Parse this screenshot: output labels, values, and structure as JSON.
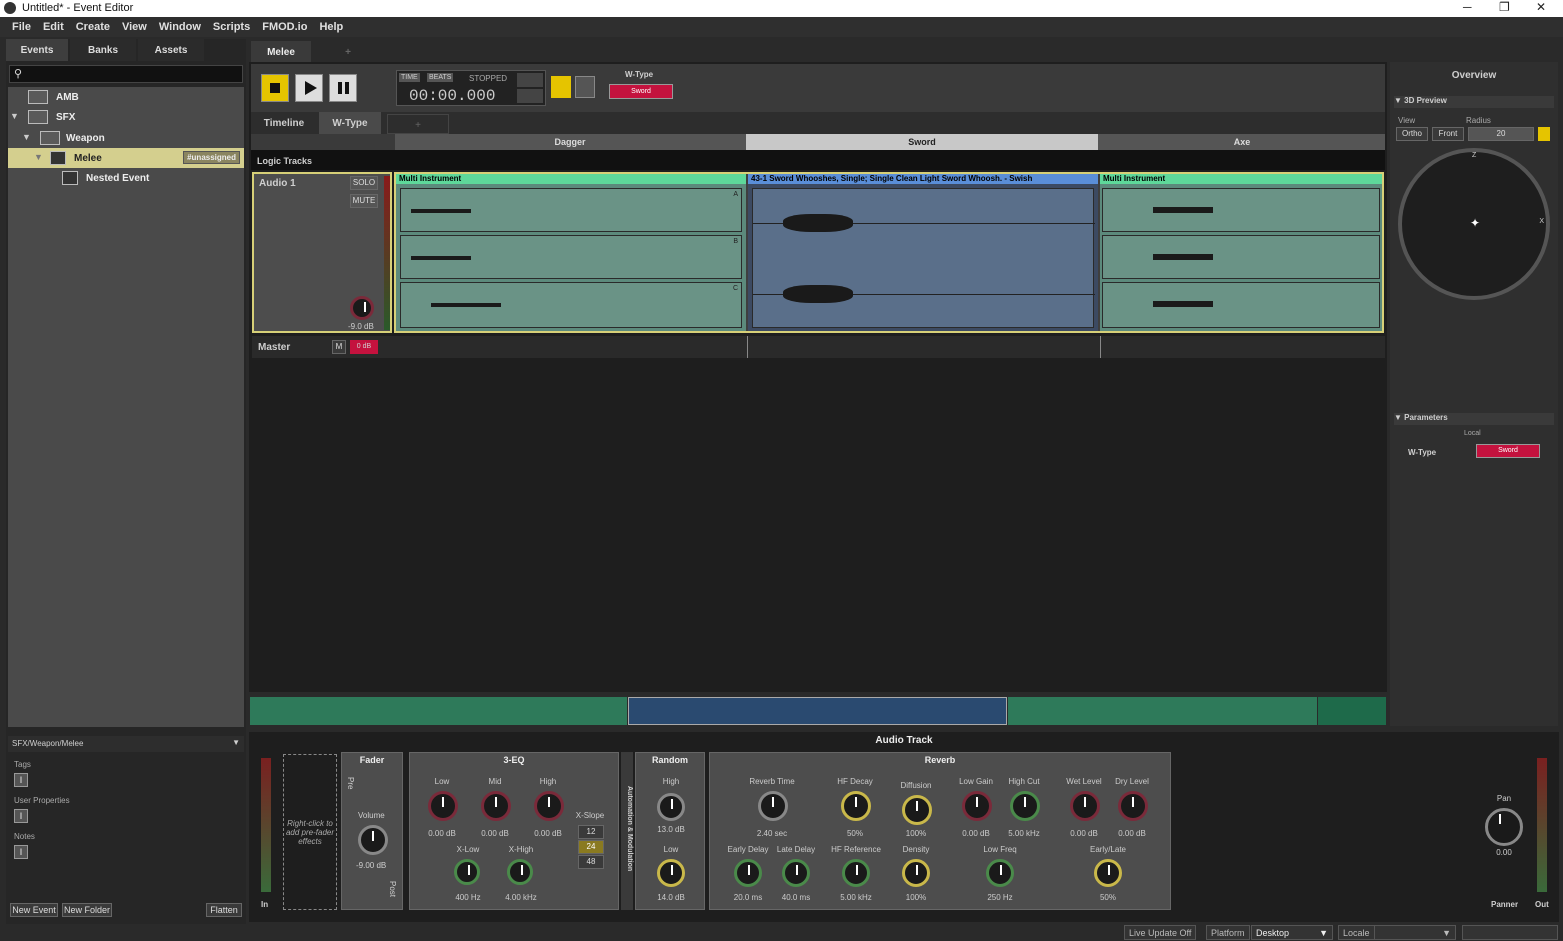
{
  "window": {
    "title": "Untitled* - Event Editor"
  },
  "menu": [
    "File",
    "Edit",
    "Create",
    "View",
    "Window",
    "Scripts",
    "FMOD.io",
    "Help"
  ],
  "browser": {
    "tabs": [
      "Events",
      "Banks",
      "Assets"
    ],
    "tree": [
      {
        "label": "AMB"
      },
      {
        "label": "SFX"
      },
      {
        "label": "Weapon"
      },
      {
        "label": "Melee",
        "badge": "#unassigned"
      },
      {
        "label": "Nested Event"
      }
    ],
    "path": "SFX/Weapon/Melee",
    "tags_label": "Tags",
    "userprops_label": "User Properties",
    "notes_label": "Notes",
    "new_event": "New Event",
    "new_folder": "New Folder",
    "flatten": "Flatten"
  },
  "editor": {
    "tab": "Melee",
    "add_tab": "+",
    "transport": {
      "time_label": "TIME",
      "beats_label": "BEATS",
      "state": "STOPPED",
      "time": "00:00.000",
      "param_label": "W-Type",
      "param_value": "Sword"
    },
    "subtabs": [
      "Timeline",
      "W-Type",
      "+"
    ],
    "ruler": [
      "Dagger",
      "Sword",
      "Axe"
    ],
    "logic_tracks": "Logic Tracks",
    "track": {
      "name": "Audio 1",
      "solo": "SOLO",
      "mute": "MUTE",
      "volume": "-9.0 dB"
    },
    "instruments": [
      {
        "name": "Multi Instrument",
        "color": "#5ed89a"
      },
      {
        "name": "43-1 Sword Whooshes, Single; Single Clean Light Sword Whoosh. - Swish",
        "color": "#5a8ed8"
      },
      {
        "name": "Multi Instrument",
        "color": "#5ed89a"
      }
    ],
    "playlist_labels": [
      "A",
      "B",
      "C"
    ],
    "master": {
      "name": "Master",
      "m": "M",
      "level": "0 dB"
    }
  },
  "overview": {
    "title": "Overview",
    "preview": "3D Preview",
    "view_label": "View",
    "radius_label": "Radius",
    "ortho": "Ortho",
    "front": "Front",
    "radius": "20",
    "z": "Z",
    "x": "X",
    "parameters": "Parameters",
    "local": "Local",
    "param": "W-Type",
    "param_value": "Sword"
  },
  "deck": {
    "title": "Audio Track",
    "in": "In",
    "prefader": "Right-click to add pre-fader effects",
    "fader": {
      "title": "Fader",
      "pre": "Pre",
      "post": "Post",
      "volume_label": "Volume",
      "volume": "-9.00 dB"
    },
    "eq": {
      "title": "3-EQ",
      "low": "Low",
      "mid": "Mid",
      "high": "High",
      "low_v": "0.00 dB",
      "mid_v": "0.00 dB",
      "high_v": "0.00 dB",
      "xlow": "X-Low",
      "xhigh": "X-High",
      "xlow_v": "400 Hz",
      "xhigh_v": "4.00 kHz",
      "xslope": "X-Slope",
      "s12": "12",
      "s24": "24",
      "s48": "48"
    },
    "mod": "Automation & Modulation",
    "random": {
      "title": "Random",
      "high": "High",
      "high_v": "13.0 dB",
      "low": "Low",
      "low_v": "14.0 dB"
    },
    "reverb": {
      "title": "Reverb",
      "rt": "Reverb Time",
      "rt_v": "2.40 sec",
      "hfd": "HF Decay",
      "hfd_v": "50%",
      "diff": "Diffusion",
      "diff_v": "100%",
      "lg": "Low Gain",
      "lg_v": "0.00 dB",
      "hc": "High Cut",
      "hc_v": "5.00 kHz",
      "wl": "Wet Level",
      "wl_v": "0.00 dB",
      "dl": "Dry Level",
      "dl_v": "0.00 dB",
      "ed": "Early Delay",
      "ed_v": "20.0 ms",
      "ld": "Late Delay",
      "ld_v": "40.0 ms",
      "hfr": "HF Reference",
      "hfr_v": "5.00 kHz",
      "den": "Density",
      "den_v": "100%",
      "lf": "Low Freq",
      "lf_v": "250 Hz",
      "el": "Early/Late",
      "el_v": "50%"
    },
    "pan": "Pan",
    "pan_v": "0.00",
    "panner": "Panner",
    "out": "Out"
  },
  "status": {
    "live": "Live Update Off",
    "platform_label": "Platform",
    "platform": "Desktop",
    "locale": "Locale"
  }
}
